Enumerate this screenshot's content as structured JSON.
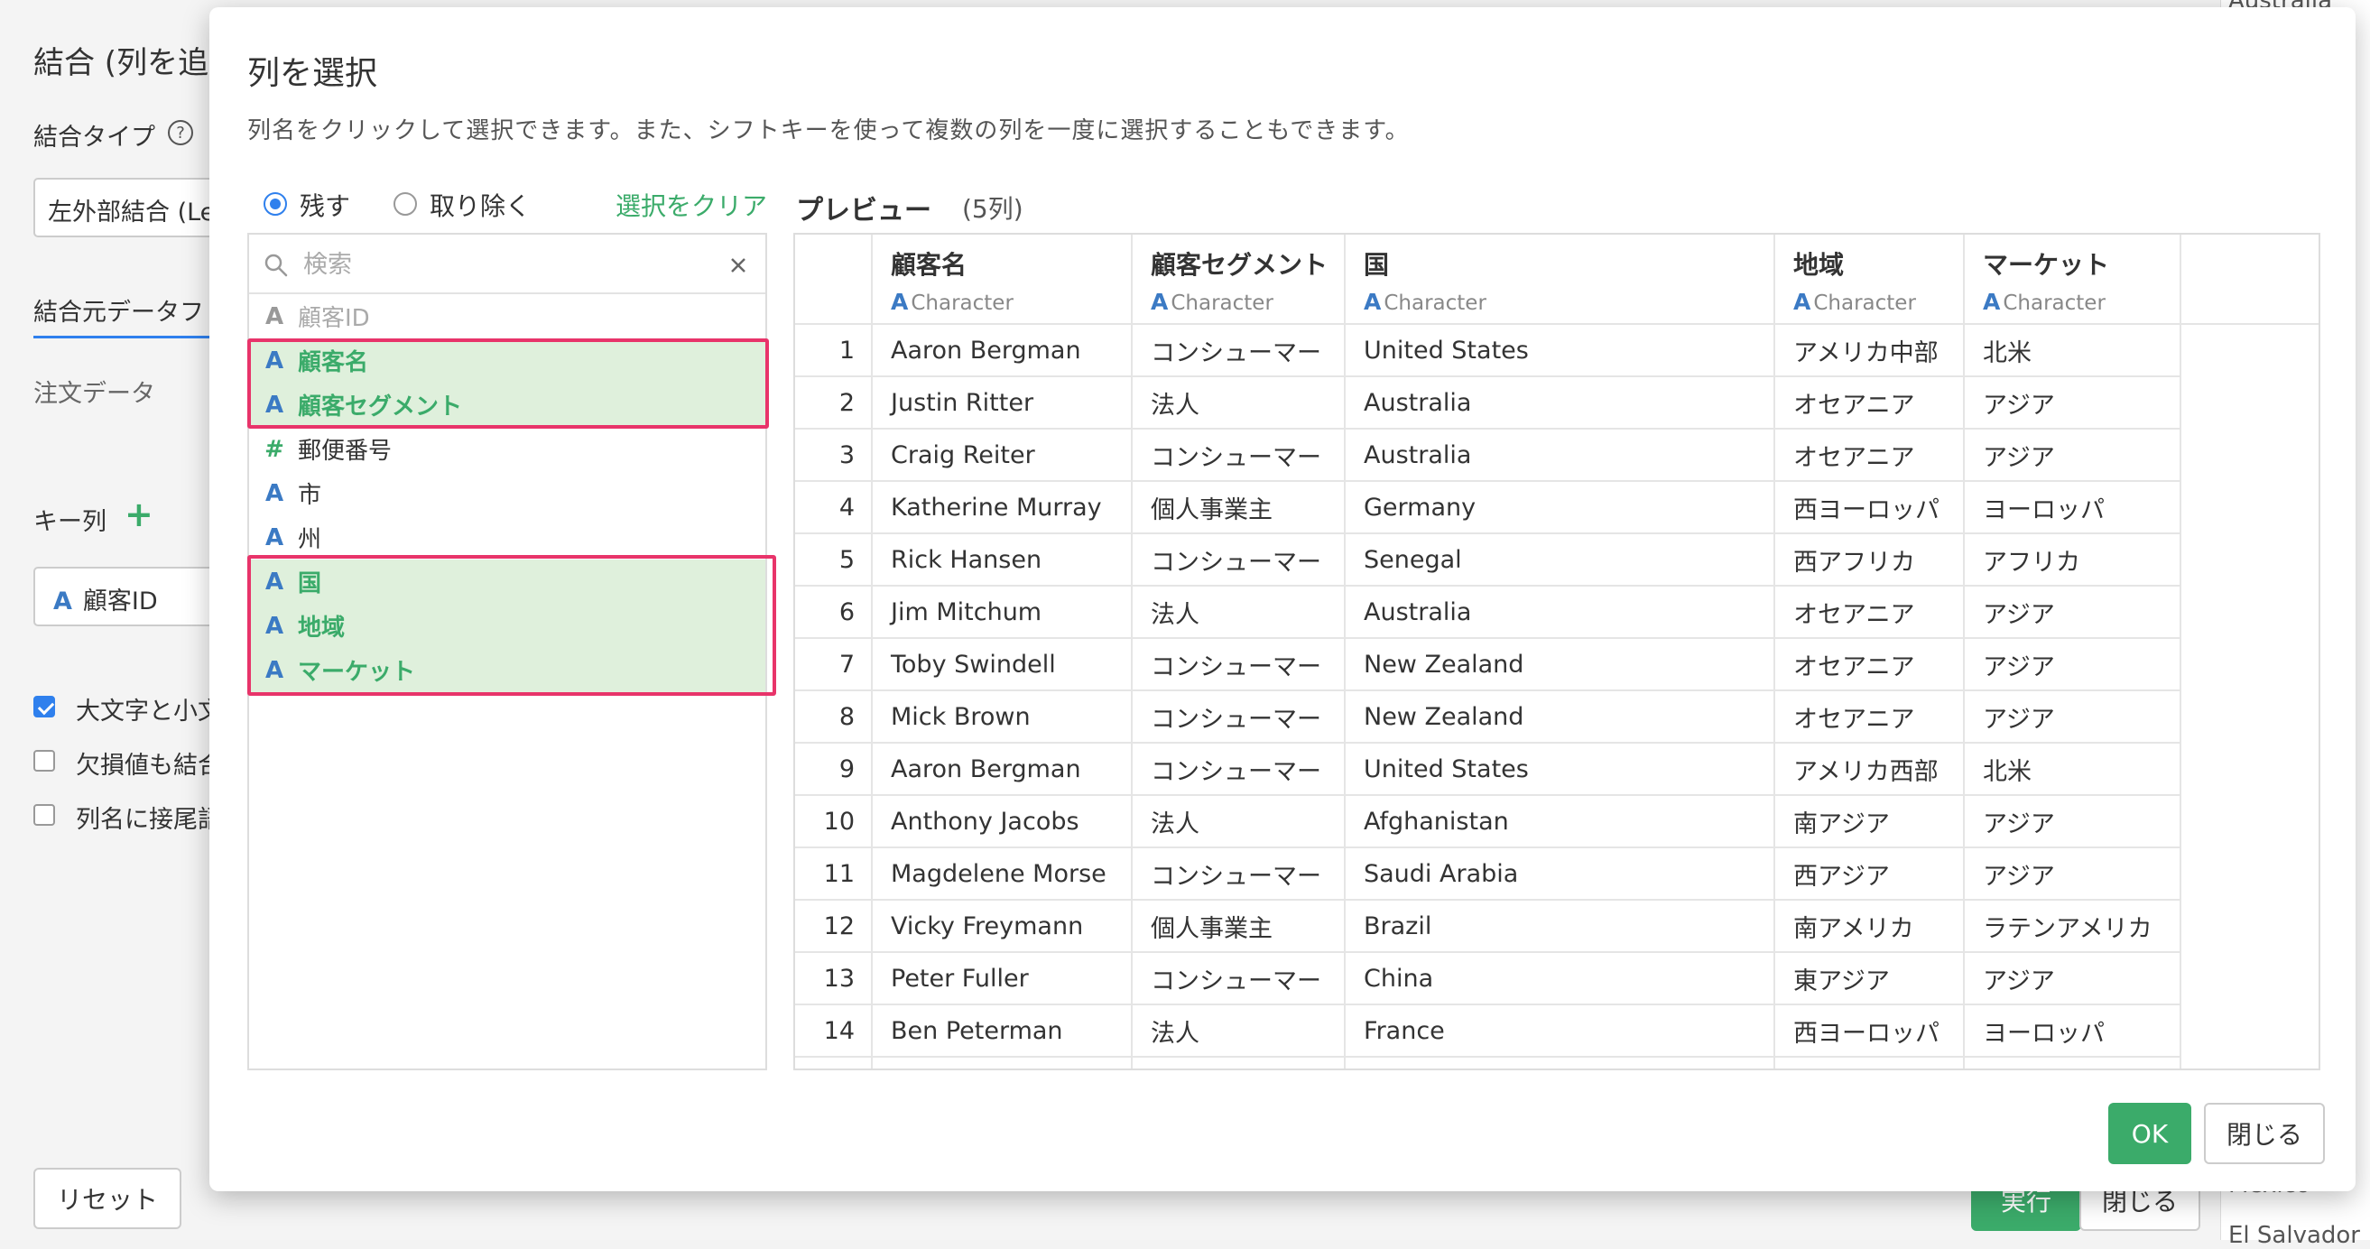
{
  "background": {
    "title": "結合 (列を追",
    "join_type_label": "結合タイプ",
    "help_icon": "question-circle-icon",
    "join_type_value": "左外部結合 (Le",
    "source_tab": "結合元データフ",
    "source_name": "注文データ",
    "key_label": "キー列",
    "key_value": "顧客ID",
    "checks": [
      {
        "label": "大文字と小文",
        "checked": true
      },
      {
        "label": "欠損値も結合",
        "checked": false
      },
      {
        "label": "列名に接尾語",
        "checked": false
      }
    ],
    "reset_button": "リセット",
    "run_button": "実行",
    "close_button": "閉じる",
    "right_peek": [
      "Australia",
      "Mexico",
      "El Salvador"
    ]
  },
  "modal": {
    "title": "列を選択",
    "description": "列名をクリックして選択できます。また、シフトキーを使って複数の列を一度に選択することもできます。",
    "radio_keep": "残す",
    "radio_remove": "取り除く",
    "clear_selection": "選択をクリア",
    "search_placeholder": "検索",
    "columns": [
      {
        "name": "顧客ID",
        "type": "A",
        "state": "disabled"
      },
      {
        "name": "顧客名",
        "type": "A",
        "state": "selected"
      },
      {
        "name": "顧客セグメント",
        "type": "A",
        "state": "selected"
      },
      {
        "name": "郵便番号",
        "type": "#",
        "state": "normal"
      },
      {
        "name": "市",
        "type": "A",
        "state": "normal"
      },
      {
        "name": "州",
        "type": "A",
        "state": "normal"
      },
      {
        "name": "国",
        "type": "A",
        "state": "selected"
      },
      {
        "name": "地域",
        "type": "A",
        "state": "selected"
      },
      {
        "name": "マーケット",
        "type": "A",
        "state": "selected"
      }
    ],
    "preview_title": "プレビュー",
    "preview_count": "(5列)",
    "table": {
      "headers": [
        {
          "name": "顧客名",
          "type": "Character"
        },
        {
          "name": "顧客セグメント",
          "type": "Character"
        },
        {
          "name": "国",
          "type": "Character"
        },
        {
          "name": "地域",
          "type": "Character"
        },
        {
          "name": "マーケット",
          "type": "Character"
        }
      ],
      "type_letter": "A",
      "rows": [
        [
          "1",
          "Aaron Bergman",
          "コンシューマー",
          "United States",
          "アメリカ中部",
          "北米"
        ],
        [
          "2",
          "Justin Ritter",
          "法人",
          "Australia",
          "オセアニア",
          "アジア"
        ],
        [
          "3",
          "Craig Reiter",
          "コンシューマー",
          "Australia",
          "オセアニア",
          "アジア"
        ],
        [
          "4",
          "Katherine Murray",
          "個人事業主",
          "Germany",
          "西ヨーロッパ",
          "ヨーロッパ"
        ],
        [
          "5",
          "Rick Hansen",
          "コンシューマー",
          "Senegal",
          "西アフリカ",
          "アフリカ"
        ],
        [
          "6",
          "Jim Mitchum",
          "法人",
          "Australia",
          "オセアニア",
          "アジア"
        ],
        [
          "7",
          "Toby Swindell",
          "コンシューマー",
          "New Zealand",
          "オセアニア",
          "アジア"
        ],
        [
          "8",
          "Mick Brown",
          "コンシューマー",
          "New Zealand",
          "オセアニア",
          "アジア"
        ],
        [
          "9",
          "Aaron Bergman",
          "コンシューマー",
          "United States",
          "アメリカ西部",
          "北米"
        ],
        [
          "10",
          "Anthony Jacobs",
          "法人",
          "Afghanistan",
          "南アジア",
          "アジア"
        ],
        [
          "11",
          "Magdelene Morse",
          "コンシューマー",
          "Saudi Arabia",
          "西アジア",
          "アジア"
        ],
        [
          "12",
          "Vicky Freymann",
          "個人事業主",
          "Brazil",
          "南アメリカ",
          "ラテンアメリカ"
        ],
        [
          "13",
          "Peter Fuller",
          "コンシューマー",
          "China",
          "東アジア",
          "アジア"
        ],
        [
          "14",
          "Ben Peterman",
          "法人",
          "France",
          "西ヨーロッパ",
          "ヨーロッパ"
        ]
      ]
    },
    "ok_button": "OK",
    "close_button": "閉じる"
  },
  "colors": {
    "accent_green": "#3bab6a",
    "selected_bg": "#dff0dc",
    "highlight_pink": "#e8346a",
    "type_blue": "#3b7ac4"
  }
}
